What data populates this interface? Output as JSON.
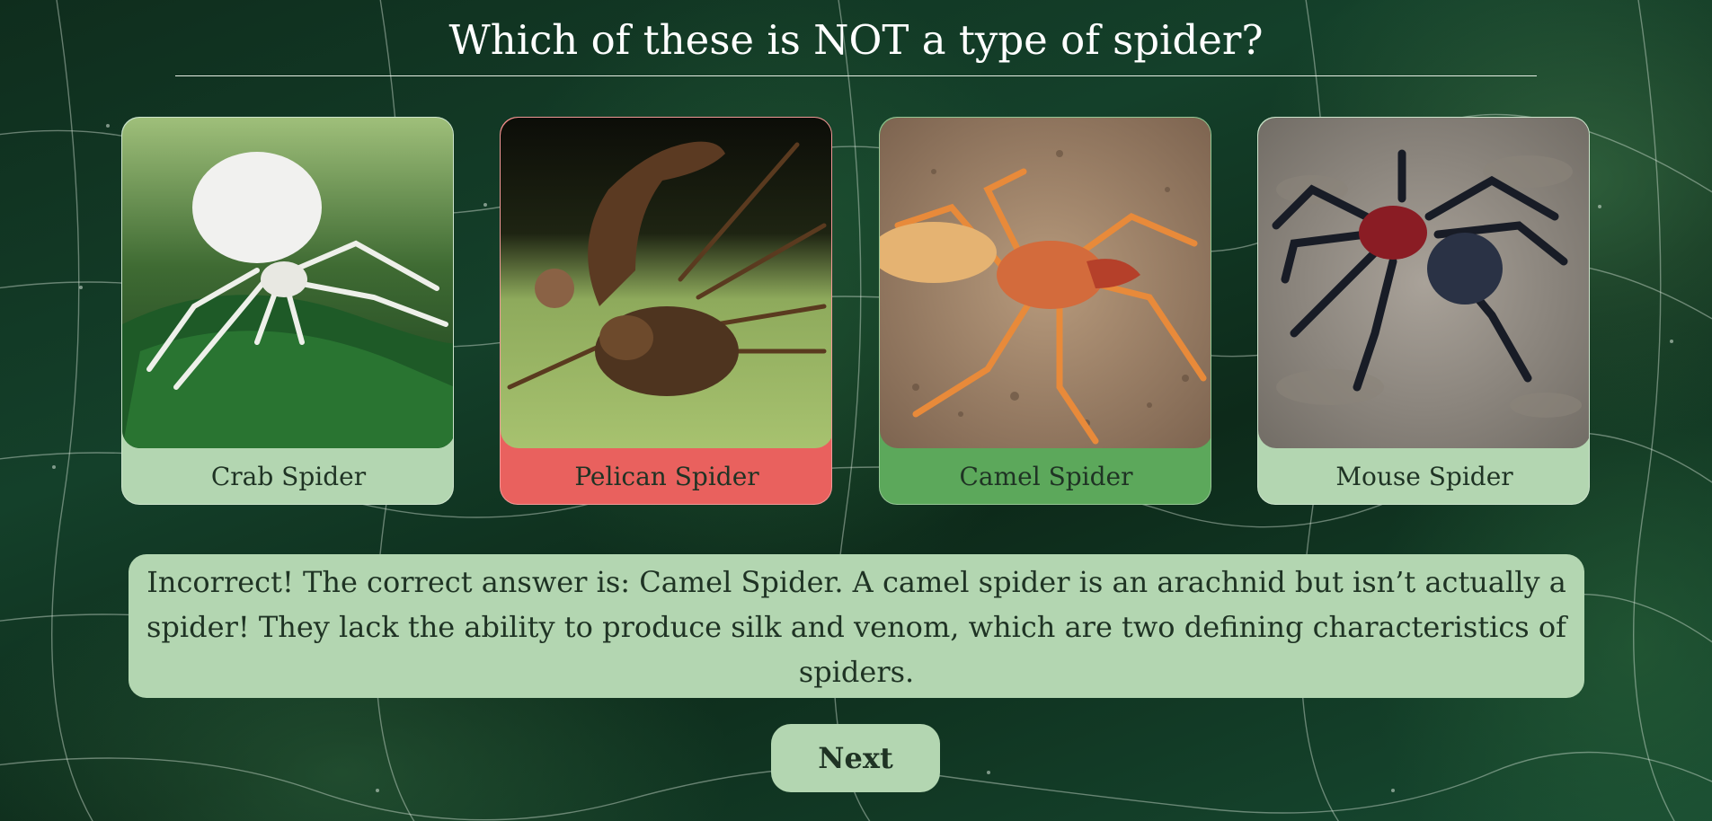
{
  "question": {
    "title": "Which of these is NOT a type of spider?"
  },
  "options": [
    {
      "label": "Crab Spider",
      "state": "neutral",
      "image": "crab-spider-photo"
    },
    {
      "label": "Pelican Spider",
      "state": "selected-incorrect",
      "image": "pelican-spider-photo"
    },
    {
      "label": "Camel Spider",
      "state": "correct",
      "image": "camel-spider-photo"
    },
    {
      "label": "Mouse Spider",
      "state": "neutral",
      "image": "mouse-spider-photo"
    }
  ],
  "feedback": {
    "text": "Incorrect! The correct answer is: Camel Spider. A camel spider is an arachnid but isn’t actually a spider! They lack the ability to produce silk and venom, which are two defining characteristics of spiders."
  },
  "controls": {
    "next_label": "Next"
  },
  "colors": {
    "card_neutral": "#b3d6b1",
    "card_incorrect": "#e9615e",
    "card_correct": "#5ca85b",
    "text_dark": "#1f3324",
    "title_text": "#ffffff"
  }
}
